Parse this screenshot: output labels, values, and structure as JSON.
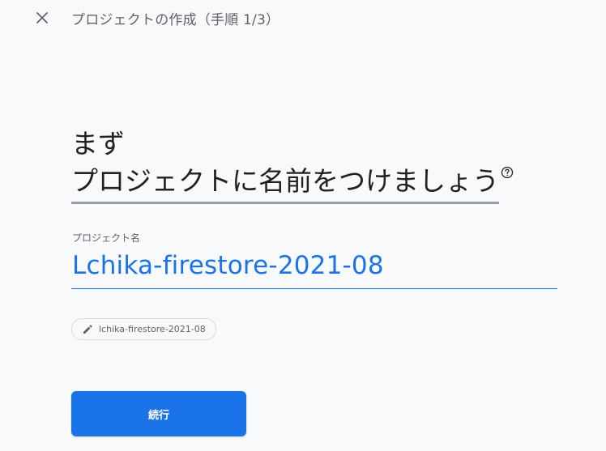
{
  "header": {
    "title": "プロジェクトの作成（手順 1/3）",
    "close_icon": "close-icon"
  },
  "heading": {
    "line1": "まず",
    "line2": "プロジェクトに名前をつけましょう",
    "help_icon": "help-circle-icon"
  },
  "project_name_field": {
    "label": "プロジェクト名",
    "value": "Lchika-firestore-2021-08"
  },
  "project_id_chip": {
    "icon": "pencil-icon",
    "text": "lchika-firestore-2021-08"
  },
  "continue_button": {
    "label": "続行"
  },
  "colors": {
    "accent": "#1a73e8",
    "background": "#f8f9fa",
    "text_primary": "#202124",
    "text_secondary": "#5f6368"
  }
}
